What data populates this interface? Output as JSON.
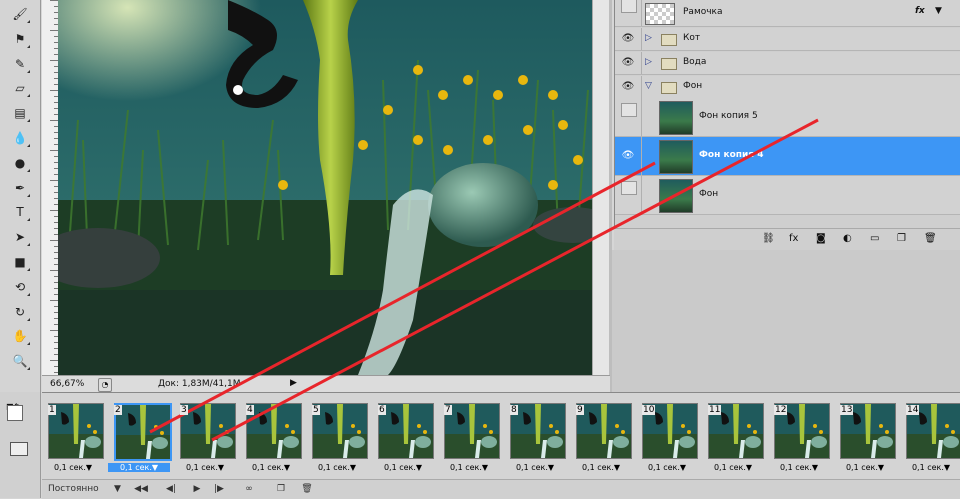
{
  "tools": [
    {
      "icon": "brush-icon",
      "glyph": "🖌"
    },
    {
      "icon": "clone-stamp-icon",
      "glyph": "⚑"
    },
    {
      "icon": "history-brush-icon",
      "glyph": "✎"
    },
    {
      "icon": "eraser-icon",
      "glyph": "▱"
    },
    {
      "icon": "gradient-icon",
      "glyph": "▤"
    },
    {
      "icon": "blur-icon",
      "glyph": "💧"
    },
    {
      "icon": "dodge-icon",
      "glyph": "●"
    },
    {
      "icon": "pen-icon",
      "glyph": "✒"
    },
    {
      "icon": "type-icon",
      "glyph": "T"
    },
    {
      "icon": "path-select-icon",
      "glyph": "➤"
    },
    {
      "icon": "rectangle-icon",
      "glyph": "■"
    },
    {
      "icon": "3d-rotate-icon",
      "glyph": "⟲"
    },
    {
      "icon": "3d-orbit-icon",
      "glyph": "↻"
    },
    {
      "icon": "hand-icon",
      "glyph": "✋"
    },
    {
      "icon": "zoom-icon",
      "glyph": "🔍"
    }
  ],
  "status": {
    "zoom": "66,67%",
    "doc": "Док: 1,83M/41,1M"
  },
  "layers": [
    {
      "name": "Рамочка",
      "type": "layer",
      "visible": false,
      "fx": "fx"
    },
    {
      "name": "Кот",
      "type": "group",
      "visible": true,
      "expanded": false
    },
    {
      "name": "Вода",
      "type": "group",
      "visible": true,
      "expanded": false
    },
    {
      "name": "Фон",
      "type": "group",
      "visible": true,
      "expanded": true
    },
    {
      "name": "Фон копия 5",
      "type": "layer",
      "visible": false
    },
    {
      "name": "Фон копия 4",
      "type": "layer",
      "visible": true,
      "selected": true
    },
    {
      "name": "Фон",
      "type": "layer",
      "visible": false
    }
  ],
  "layer_footer_icons": [
    "link-icon",
    "fx-icon",
    "mask-icon",
    "adjustment-icon",
    "folder-icon",
    "new-layer-icon",
    "trash-icon"
  ],
  "layer_footer_glyphs": [
    "⛓",
    "fx",
    "◙",
    "◐",
    "▭",
    "❐",
    "🗑"
  ],
  "frames": [
    {
      "num": "1",
      "delay": "0,1 сек."
    },
    {
      "num": "2",
      "delay": "0,1 сек.",
      "selected": true
    },
    {
      "num": "3",
      "delay": "0,1 сек."
    },
    {
      "num": "4",
      "delay": "0,1 сек."
    },
    {
      "num": "5",
      "delay": "0,1 сек."
    },
    {
      "num": "6",
      "delay": "0,1 сек."
    },
    {
      "num": "7",
      "delay": "0,1 сек."
    },
    {
      "num": "8",
      "delay": "0,1 сек."
    },
    {
      "num": "9",
      "delay": "0,1 сек."
    },
    {
      "num": "10",
      "delay": "0,1 сек."
    },
    {
      "num": "11",
      "delay": "0,1 сек."
    },
    {
      "num": "12",
      "delay": "0,1 сек."
    },
    {
      "num": "13",
      "delay": "0,1 сек."
    },
    {
      "num": "14",
      "delay": "0,1 сек."
    }
  ],
  "anim_footer": {
    "loop": "Постоянно"
  },
  "colors": {
    "selection": "#3d96f5",
    "annotation": "#e8252b"
  }
}
